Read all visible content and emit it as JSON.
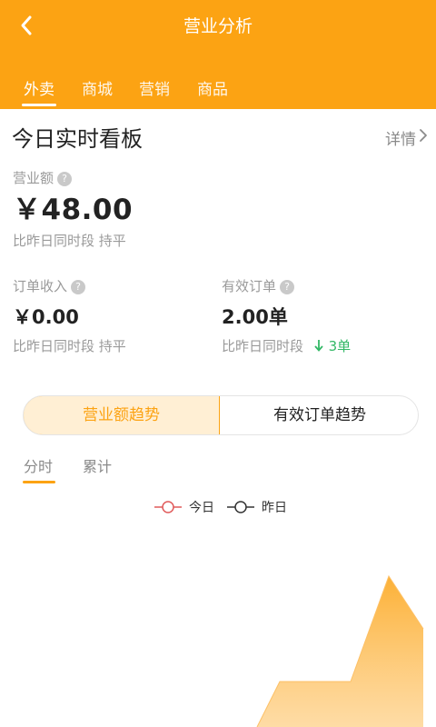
{
  "header": {
    "title": "营业分析",
    "tabs": [
      {
        "label": "外卖",
        "active": true
      },
      {
        "label": "商城",
        "active": false
      },
      {
        "label": "营销",
        "active": false
      },
      {
        "label": "商品",
        "active": false
      }
    ]
  },
  "board": {
    "title": "今日实时看板",
    "detail_label": "详情"
  },
  "revenue": {
    "label": "营业额",
    "value": "￥48.00",
    "compare": "比昨日同时段 持平"
  },
  "order_income": {
    "label": "订单收入",
    "value": "￥0.00",
    "compare": "比昨日同时段 持平"
  },
  "valid_orders": {
    "label": "有效订单",
    "value": "2.00单",
    "compare_prefix": "比昨日同时段",
    "compare_change": "3单",
    "compare_direction": "down"
  },
  "trend_toggle": {
    "left": "营业额趋势",
    "right": "有效订单趋势",
    "selected": "left"
  },
  "subtabs": [
    {
      "label": "分时",
      "active": true
    },
    {
      "label": "累计",
      "active": false
    }
  ],
  "legend": [
    {
      "name": "今日",
      "color": "#e05a5a"
    },
    {
      "name": "昨日",
      "color": "#333333"
    }
  ],
  "colors": {
    "accent": "#fca313",
    "down_green": "#33b866"
  }
}
